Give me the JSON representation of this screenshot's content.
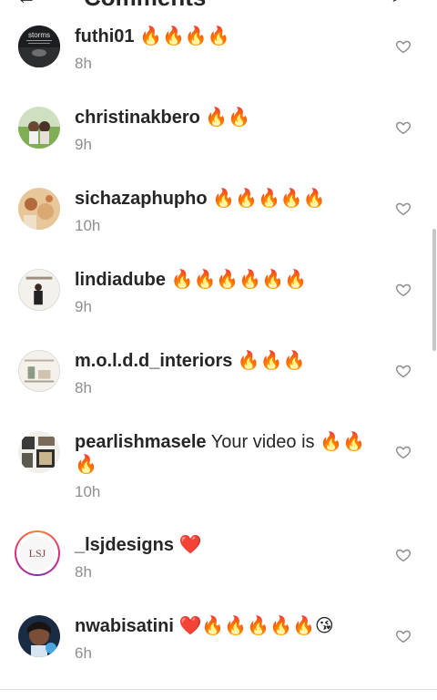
{
  "header": {
    "title": "Comments",
    "back_icon": "back-arrow-icon",
    "send_icon": "send-icon"
  },
  "colors": {
    "text": "#262626",
    "secondary": "#8e8e8e",
    "heart_outline": "#8e8e8e",
    "red_heart": "#e0245e"
  },
  "comments": [
    {
      "username": "futhi01",
      "message": " 🔥🔥🔥🔥",
      "time": "8h",
      "avatar_label": "storms"
    },
    {
      "username": "christinakbero",
      "message": " 🔥🔥",
      "time": "9h",
      "avatar_label": ""
    },
    {
      "username": "sichazaphupho",
      "message": " 🔥🔥🔥🔥🔥",
      "time": "10h",
      "avatar_label": ""
    },
    {
      "username": "lindiadube",
      "message": " 🔥🔥🔥🔥🔥🔥",
      "time": "9h",
      "avatar_label": ""
    },
    {
      "username": "m.o.l.d.d_interiors",
      "message": " 🔥🔥🔥",
      "time": "8h",
      "avatar_label": ""
    },
    {
      "username": "pearlishmasele",
      "message": " Your video is 🔥🔥🔥",
      "time": "10h",
      "avatar_label": ""
    },
    {
      "username": "_lsjdesigns",
      "message": " ❤️",
      "time": "8h",
      "avatar_label": "LSJ"
    },
    {
      "username": "nwabisatini",
      "message": " ❤️🔥🔥🔥🔥🔥😘",
      "time": "6h",
      "avatar_label": ""
    }
  ]
}
